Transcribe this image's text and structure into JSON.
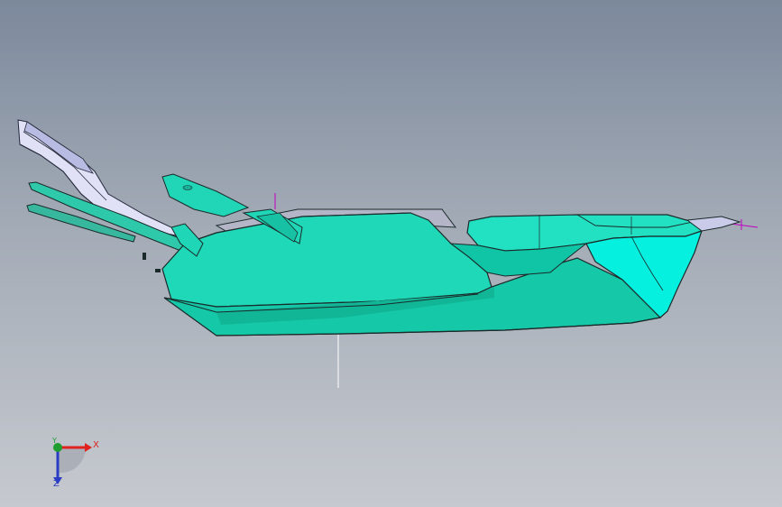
{
  "viewport": {
    "background_top": "#7c899c",
    "background_bottom": "#c6c9cf"
  },
  "model": {
    "part_color": "#00d4b4",
    "part_shadow_color": "#00a88e",
    "part_edge_color": "#1a2a2a",
    "bracket_color": "#d8d9f2",
    "reference_line_color": "#c000c0"
  },
  "triad": {
    "x_label": "X",
    "y_label": "Y",
    "z_label": "Z",
    "x_color": "#e0231e",
    "y_color": "#1f9d2e",
    "z_color": "#2a3cc4"
  }
}
